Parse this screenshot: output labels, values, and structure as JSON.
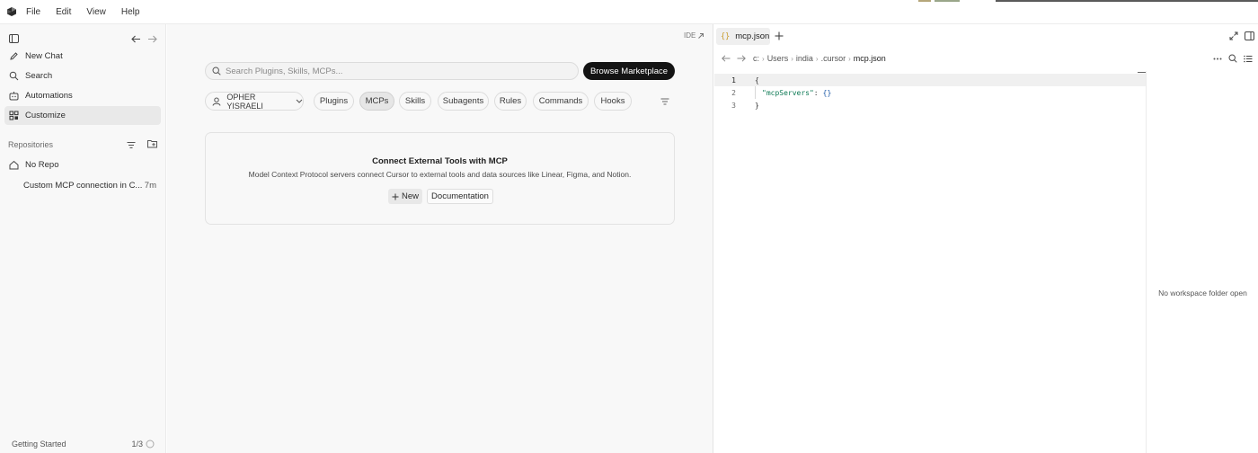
{
  "menu": {
    "items": [
      "File",
      "Edit",
      "View",
      "Help"
    ]
  },
  "sidebar": {
    "nav": [
      {
        "label": "New Chat",
        "icon": "pencil-icon"
      },
      {
        "label": "Search",
        "icon": "search-icon"
      },
      {
        "label": "Automations",
        "icon": "bot-icon"
      },
      {
        "label": "Customize",
        "icon": "grid-icon",
        "active": true
      }
    ],
    "repositories_label": "Repositories",
    "repo_name": "No Repo",
    "recent_chat": "Custom MCP connection in C...",
    "recent_chat_time": "7m",
    "getting_started": "Getting Started",
    "getting_started_progress": "1/3"
  },
  "main": {
    "ide_link": "IDE",
    "search_placeholder": "Search Plugins, Skills, MCPs...",
    "browse_button": "Browse Marketplace",
    "user_filter": "OPHER YISRAELI",
    "tabs": [
      "Plugins",
      "MCPs",
      "Skills",
      "Subagents",
      "Rules",
      "Commands",
      "Hooks"
    ],
    "active_tab": "MCPs",
    "card": {
      "title": "Connect External Tools with MCP",
      "description": "Model Context Protocol servers connect Cursor to external tools and data sources like Linear, Figma, and Notion.",
      "new_button": "New",
      "doc_button": "Documentation"
    }
  },
  "editor": {
    "tab_icon_text": "{}",
    "tab_name": "mcp.json",
    "breadcrumbs": [
      "c:",
      "Users",
      "india",
      ".cursor",
      "mcp.json"
    ],
    "line_numbers": [
      "1",
      "2",
      "3"
    ],
    "code": {
      "open_brace": "{",
      "key": "\"mcpServers\"",
      "colon": ":",
      "value": "{}",
      "close_brace": "}"
    },
    "no_workspace": "No workspace folder open"
  },
  "colors": {
    "accent_dark": "#141414",
    "json_key": "#0e7a55",
    "json_brace": "#1e5aa8",
    "tab_icon": "#c79a2a"
  }
}
